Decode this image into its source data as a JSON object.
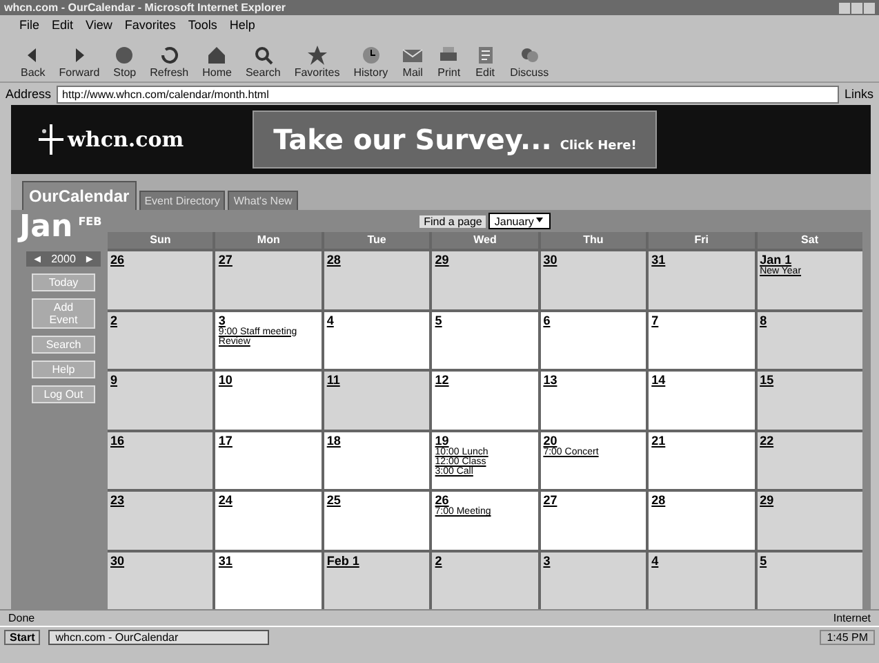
{
  "window": {
    "title": "whcn.com - OurCalendar - Microsoft Internet Explorer"
  },
  "menu": [
    "File",
    "Edit",
    "View",
    "Favorites",
    "Tools",
    "Help"
  ],
  "toolbar": [
    {
      "label": "Back",
      "kind": "back"
    },
    {
      "label": "Forward",
      "kind": "forward"
    },
    {
      "label": "Stop",
      "kind": "stop"
    },
    {
      "label": "Refresh",
      "kind": "refresh"
    },
    {
      "label": "Home",
      "kind": "home"
    },
    {
      "label": "Search",
      "kind": "search"
    },
    {
      "label": "Favorites",
      "kind": "favorites"
    },
    {
      "label": "History",
      "kind": "history"
    },
    {
      "label": "Mail",
      "kind": "mail"
    },
    {
      "label": "Print",
      "kind": "print"
    },
    {
      "label": "Edit",
      "kind": "edit"
    },
    {
      "label": "Discuss",
      "kind": "discuss"
    }
  ],
  "address": {
    "label": "Address",
    "value": "http://www.whcn.com/calendar/month.html",
    "links": "Links"
  },
  "banner": {
    "logo": "whcn.com",
    "ad": "Take our Survey...",
    "ad_link": "Click Here!"
  },
  "tabs": [
    {
      "label": "OurCalendar",
      "selected": true
    },
    {
      "label": "Event Directory",
      "selected": false
    },
    {
      "label": "What's New",
      "selected": false
    }
  ],
  "calendar": {
    "month": "Jan",
    "next": "FEB",
    "year": "2000",
    "prev": "◄",
    "nextyear": "►",
    "jump": {
      "label": "Find a page",
      "value": "January"
    },
    "side_buttons": [
      "Today",
      "Add Event",
      "Search",
      "Help",
      "Log Out"
    ],
    "weekdays": [
      "Sun",
      "Mon",
      "Tue",
      "Wed",
      "Thu",
      "Fri",
      "Sat"
    ],
    "weeks": [
      [
        {
          "day": "26",
          "shaded": true
        },
        {
          "day": "27",
          "shaded": true
        },
        {
          "day": "28",
          "shaded": true
        },
        {
          "day": "29",
          "shaded": true
        },
        {
          "day": "30",
          "shaded": true
        },
        {
          "day": "31",
          "shaded": true
        },
        {
          "day": "Jan 1",
          "shaded": true,
          "events": [
            "New Year"
          ]
        }
      ],
      [
        {
          "day": "2",
          "shaded": true
        },
        {
          "day": "3",
          "shaded": false,
          "events": [
            "9:00 Staff meeting",
            "Review"
          ]
        },
        {
          "day": "4",
          "shaded": false
        },
        {
          "day": "5",
          "shaded": false
        },
        {
          "day": "6",
          "shaded": false
        },
        {
          "day": "7",
          "shaded": false
        },
        {
          "day": "8",
          "shaded": true
        }
      ],
      [
        {
          "day": "9",
          "shaded": true
        },
        {
          "day": "10",
          "shaded": false
        },
        {
          "day": "11",
          "shaded": true
        },
        {
          "day": "12",
          "shaded": false
        },
        {
          "day": "13",
          "shaded": false
        },
        {
          "day": "14",
          "shaded": false
        },
        {
          "day": "15",
          "shaded": true
        }
      ],
      [
        {
          "day": "16",
          "shaded": true
        },
        {
          "day": "17",
          "shaded": false
        },
        {
          "day": "18",
          "shaded": false
        },
        {
          "day": "19",
          "shaded": false,
          "events": [
            "10:00 Lunch",
            "12:00 Class",
            "3:00 Call"
          ]
        },
        {
          "day": "20",
          "shaded": false,
          "events": [
            "7:00 Concert"
          ]
        },
        {
          "day": "21",
          "shaded": false
        },
        {
          "day": "22",
          "shaded": true
        }
      ],
      [
        {
          "day": "23",
          "shaded": true
        },
        {
          "day": "24",
          "shaded": false
        },
        {
          "day": "25",
          "shaded": false
        },
        {
          "day": "26",
          "shaded": false,
          "events": [
            "7:00 Meeting"
          ]
        },
        {
          "day": "27",
          "shaded": false
        },
        {
          "day": "28",
          "shaded": false
        },
        {
          "day": "29",
          "shaded": true
        }
      ],
      [
        {
          "day": "30",
          "shaded": true
        },
        {
          "day": "31",
          "shaded": false
        },
        {
          "day": "Feb 1",
          "shaded": true
        },
        {
          "day": "2",
          "shaded": true
        },
        {
          "day": "3",
          "shaded": true
        },
        {
          "day": "4",
          "shaded": true
        },
        {
          "day": "5",
          "shaded": true
        }
      ]
    ]
  },
  "status_bar": {
    "left": "Done",
    "right": "Internet"
  },
  "taskbar": {
    "start": "Start",
    "task": "whcn.com - OurCalendar",
    "clock": "1:45 PM"
  }
}
